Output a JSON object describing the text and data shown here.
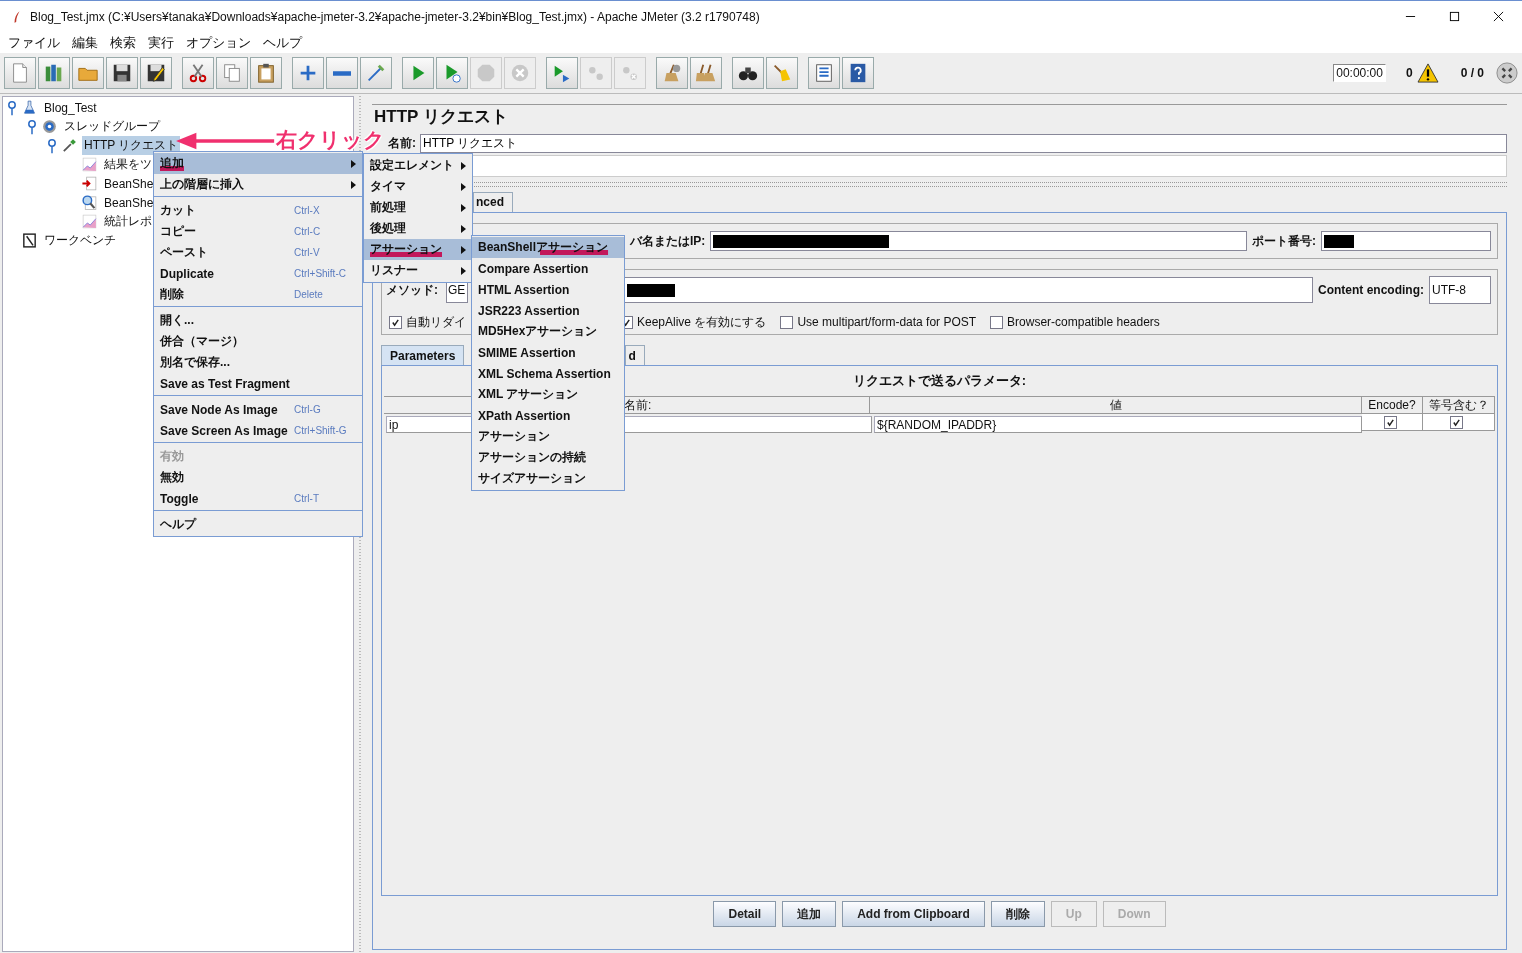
{
  "window": {
    "title": "Blog_Test.jmx (C:¥Users¥tanaka¥Downloads¥apache-jmeter-3.2¥apache-jmeter-3.2¥bin¥Blog_Test.jmx) - Apache JMeter (3.2 r1790748)"
  },
  "menu_bar": [
    "ファイル",
    "編集",
    "検索",
    "実行",
    "オプション",
    "ヘルプ"
  ],
  "toolbar": {
    "groups": [
      [
        {
          "kind": "new",
          "disabled": false
        },
        {
          "kind": "templates",
          "disabled": false
        },
        {
          "kind": "open",
          "disabled": false
        },
        {
          "kind": "save",
          "disabled": false
        },
        {
          "kind": "save_as",
          "disabled": false
        }
      ],
      [
        {
          "kind": "cut",
          "disabled": false
        },
        {
          "kind": "copy",
          "disabled": false
        },
        {
          "kind": "paste",
          "disabled": false
        }
      ],
      [
        {
          "kind": "expand",
          "disabled": false
        },
        {
          "kind": "collapse",
          "disabled": false
        },
        {
          "kind": "toggle",
          "disabled": false
        }
      ],
      [
        {
          "kind": "start",
          "disabled": false
        },
        {
          "kind": "start_no_pause",
          "disabled": false
        },
        {
          "kind": "stop",
          "disabled": true
        },
        {
          "kind": "shutdown",
          "disabled": true
        }
      ],
      [
        {
          "kind": "remote_start",
          "disabled": false
        },
        {
          "kind": "remote_stop",
          "disabled": true
        },
        {
          "kind": "remote_exit",
          "disabled": true
        }
      ],
      [
        {
          "kind": "clear",
          "disabled": false
        },
        {
          "kind": "clear_all",
          "disabled": false
        }
      ],
      [
        {
          "kind": "search",
          "disabled": false
        },
        {
          "kind": "reset_search",
          "disabled": false
        }
      ],
      [
        {
          "kind": "functions",
          "disabled": false
        },
        {
          "kind": "help",
          "disabled": false
        }
      ]
    ],
    "timer": "00:00:00",
    "warnings": "0",
    "threads": "0 / 0"
  },
  "tree": [
    {
      "label": "Blog_Test",
      "kind": "plan",
      "expanded": true,
      "selected": false,
      "children": [
        {
          "label": "スレッドグループ",
          "kind": "threads",
          "expanded": true,
          "selected": false,
          "children": [
            {
              "label": "HTTP リクエスト",
              "kind": "sampler",
              "expanded": true,
              "selected": true,
              "children": [
                {
                  "label": "結果をツ",
                  "kind": "graph",
                  "selected": false
                },
                {
                  "label": "BeanShe",
                  "kind": "preprocessor",
                  "selected": false
                },
                {
                  "label": "BeanShe",
                  "kind": "inspector",
                  "selected": false
                },
                {
                  "label": "統計レポ",
                  "kind": "graph",
                  "selected": false
                }
              ]
            }
          ]
        }
      ]
    },
    {
      "label": "ワークベンチ",
      "kind": "workbench",
      "selected": false
    }
  ],
  "annotation": {
    "text": "右クリック"
  },
  "context_menu": {
    "groups": [
      [
        {
          "label": "追加",
          "submenu": true,
          "selected": true,
          "disabled": false
        },
        {
          "label": "上の階層に挿入",
          "submenu": true,
          "selected": false,
          "disabled": false
        }
      ],
      [
        {
          "label": "カット",
          "shortcut": "Ctrl-X",
          "submenu": false,
          "selected": false,
          "disabled": false
        },
        {
          "label": "コピー",
          "shortcut": "Ctrl-C",
          "submenu": false,
          "selected": false,
          "disabled": false
        },
        {
          "label": "ペースト",
          "shortcut": "Ctrl-V",
          "submenu": false,
          "selected": false,
          "disabled": false
        },
        {
          "label": "Duplicate",
          "shortcut": "Ctrl+Shift-C",
          "submenu": false,
          "selected": false,
          "disabled": false
        },
        {
          "label": "削除",
          "shortcut": "Delete",
          "submenu": false,
          "selected": false,
          "disabled": false
        }
      ],
      [
        {
          "label": "開く...",
          "submenu": false,
          "selected": false,
          "disabled": false
        },
        {
          "label": "併合（マージ）",
          "submenu": false,
          "selected": false,
          "disabled": false
        },
        {
          "label": "別名で保存...",
          "submenu": false,
          "selected": false,
          "disabled": false
        },
        {
          "label": "Save as Test Fragment",
          "submenu": false,
          "selected": false,
          "disabled": false
        }
      ],
      [
        {
          "label": "Save Node As Image",
          "shortcut": "Ctrl-G",
          "submenu": false,
          "selected": false,
          "disabled": false
        },
        {
          "label": "Save Screen As Image",
          "shortcut": "Ctrl+Shift-G",
          "submenu": false,
          "selected": false,
          "disabled": false
        }
      ],
      [
        {
          "label": "有効",
          "submenu": false,
          "selected": false,
          "disabled": true
        },
        {
          "label": "無効",
          "submenu": false,
          "selected": false,
          "disabled": false
        },
        {
          "label": "Toggle",
          "shortcut": "Ctrl-T",
          "submenu": false,
          "selected": false,
          "disabled": false
        }
      ],
      [
        {
          "label": "ヘルプ",
          "submenu": false,
          "selected": false,
          "disabled": false
        }
      ]
    ]
  },
  "add_submenu": [
    {
      "label": "設定エレメント",
      "submenu": true,
      "selected": false
    },
    {
      "label": "タイマ",
      "submenu": true,
      "selected": false
    },
    {
      "label": "前処理",
      "submenu": true,
      "selected": false
    },
    {
      "label": "後処理",
      "submenu": true,
      "selected": false
    },
    {
      "label": "アサーション",
      "submenu": true,
      "selected": true
    },
    {
      "label": "リスナー",
      "submenu": true,
      "selected": false
    }
  ],
  "assertion_submenu": [
    {
      "label": "BeanShellアサーション",
      "selected": true
    },
    {
      "label": "Compare Assertion",
      "selected": false
    },
    {
      "label": "HTML Assertion",
      "selected": false
    },
    {
      "label": "JSR223 Assertion",
      "selected": false
    },
    {
      "label": "MD5Hexアサーション",
      "selected": false
    },
    {
      "label": "SMIME Assertion",
      "selected": false
    },
    {
      "label": "XML Schema Assertion",
      "selected": false
    },
    {
      "label": "XML アサーション",
      "selected": false
    },
    {
      "label": "XPath Assertion",
      "selected": false
    },
    {
      "label": "アサーション",
      "selected": false
    },
    {
      "label": "アサーションの持続",
      "selected": false
    },
    {
      "label": "サイズアサーション",
      "selected": false
    }
  ],
  "editor": {
    "title": "HTTP リクエスト",
    "name_label": "名前:",
    "name_value": "HTTP リクエスト",
    "tabs": [
      {
        "label": "nced",
        "selected": false
      }
    ],
    "server_label": "バ名またはIP:",
    "port_label": "ポート番号:",
    "method_label": "メソッド:",
    "method_value": "GE",
    "encoding_label": "Content encoding:",
    "encoding_value": "UTF-8",
    "options": [
      {
        "label": "自動リダイ",
        "checked": true
      },
      {
        "label": "KeepAlive を有効にする",
        "checked": true
      },
      {
        "label": "Use multipart/form-data for POST",
        "checked": false
      },
      {
        "label": "Browser-compatible headers",
        "checked": false
      }
    ],
    "sub_tabs": [
      {
        "label": "Parameters",
        "selected": true
      },
      {
        "label": "d",
        "selected": false
      }
    ],
    "params": {
      "title": "リクエストで送るパラメータ:",
      "columns": [
        "名前:",
        "値",
        "Encode?",
        "等号含む？"
      ],
      "rows": [
        {
          "name": "ip",
          "value": "${RANDOM_IPADDR}",
          "encode": true,
          "include_equals": true
        }
      ]
    },
    "buttons": [
      {
        "label": "Detail",
        "disabled": false
      },
      {
        "label": "追加",
        "disabled": false
      },
      {
        "label": "Add from Clipboard",
        "disabled": false
      },
      {
        "label": "削除",
        "disabled": false
      },
      {
        "label": "Up",
        "disabled": true
      },
      {
        "label": "Down",
        "disabled": true
      }
    ]
  }
}
